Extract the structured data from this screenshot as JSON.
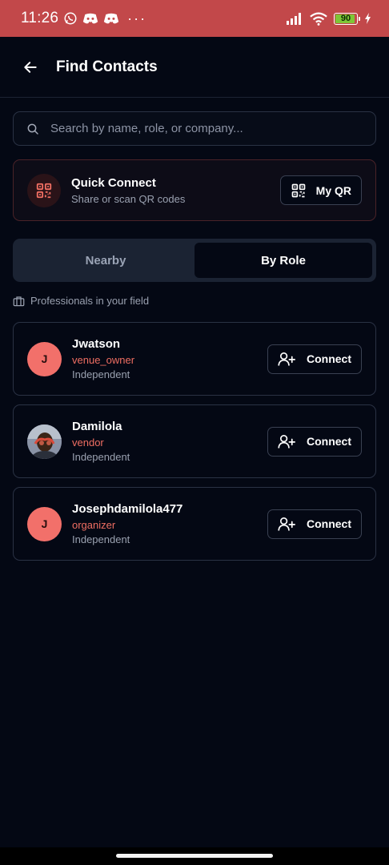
{
  "status_bar": {
    "time": "11:26",
    "battery_level": "90",
    "notification_dots": "···",
    "color": "#c2484a"
  },
  "header": {
    "title": "Find Contacts",
    "back_icon": "arrow-left-icon"
  },
  "search": {
    "placeholder": "Search by name, role, or company..."
  },
  "quick_connect": {
    "title": "Quick Connect",
    "subtitle": "Share or scan QR codes",
    "button_label": "My QR",
    "accent": "#ef6e62"
  },
  "tabs": [
    {
      "label": "Nearby",
      "active": false
    },
    {
      "label": "By Role",
      "active": true
    }
  ],
  "section_label": "Professionals in your field",
  "contacts": [
    {
      "initial": "J",
      "name": "Jwatson",
      "role": "venue_owner",
      "company": "Independent",
      "button": "Connect",
      "avatar": "initial"
    },
    {
      "initial": "",
      "name": "Damilola",
      "role": "vendor",
      "company": "Independent",
      "button": "Connect",
      "avatar": "photo"
    },
    {
      "initial": "J",
      "name": "Josephdamilola477",
      "role": "organizer",
      "company": "Independent",
      "button": "Connect",
      "avatar": "initial"
    }
  ],
  "colors": {
    "background": "#040814",
    "role_text": "#ef6e62",
    "avatar": "#f2706a"
  }
}
